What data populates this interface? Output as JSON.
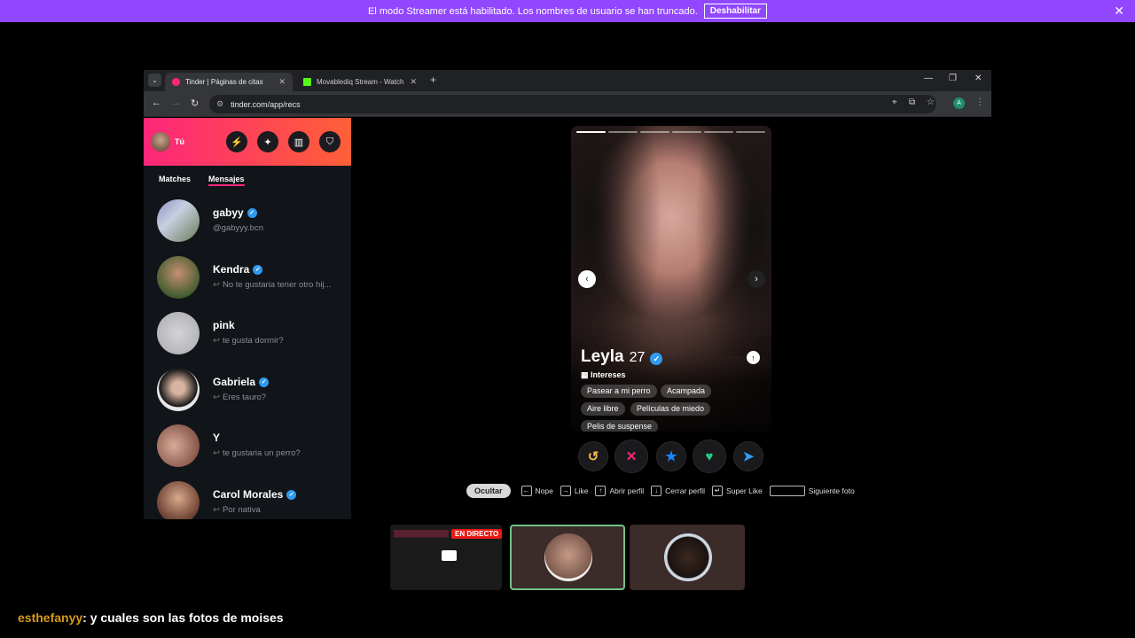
{
  "banner": {
    "text": "El modo Streamer está habilitado. Los nombres de usuario se han truncado.",
    "button": "Deshabilitar",
    "close": "✕",
    "color": "#9147ff"
  },
  "browser": {
    "tabs": [
      {
        "title": "Tinder | Páginas de citas",
        "close": "✕"
      },
      {
        "title": "Movablediq Stream - Watch Liv",
        "close": "✕"
      }
    ],
    "new_tab": "+",
    "url": "tinder.com/app/recs",
    "profile_initial": "A",
    "window_controls": {
      "minimize": "—",
      "restore": "❐",
      "close": "✕"
    }
  },
  "tinder": {
    "me_label": "Tú",
    "accent_color": "#fd267a",
    "tabs": {
      "matches": "Matches",
      "messages": "Mensajes"
    },
    "messages": [
      {
        "name": "gabyy",
        "verified": true,
        "preview": "@gabyyy.bcn",
        "reply": false
      },
      {
        "name": "Kendra",
        "verified": true,
        "preview": "No te gustaria tener otro hij...",
        "reply": true
      },
      {
        "name": "pink",
        "verified": false,
        "preview": "te gusta dormir?",
        "reply": true
      },
      {
        "name": "Gabriela",
        "verified": true,
        "preview": "Eres tauro?",
        "reply": true
      },
      {
        "name": "Y",
        "verified": false,
        "preview": "te gustaria un perro?",
        "reply": true
      },
      {
        "name": "Carol Morales",
        "verified": true,
        "preview": "Por nativa",
        "reply": true
      }
    ],
    "card": {
      "name": "Leyla",
      "age": "27",
      "interests_label": "Intereses",
      "interests": [
        "Pasear a mi perro",
        "Acampada",
        "Aire libre",
        "Películas de miedo",
        "Pelis de suspense"
      ],
      "photo_count": 6,
      "active_photo": 1
    },
    "shortcuts": {
      "hide": "Ocultar",
      "items": [
        {
          "key": "←",
          "label": "Nope"
        },
        {
          "key": "→",
          "label": "Like"
        },
        {
          "key": "↑",
          "label": "Abrir perfil"
        },
        {
          "key": "↓",
          "label": "Cerrar perfil"
        },
        {
          "key": "↵",
          "label": "Super Like"
        },
        {
          "key": "",
          "label": "Siguiente foto"
        }
      ]
    }
  },
  "stream": {
    "live_badge": "EN DIRECTO",
    "chat": {
      "user": "esthefanyy",
      "message": ": y cuales son las fotos de moises"
    }
  }
}
